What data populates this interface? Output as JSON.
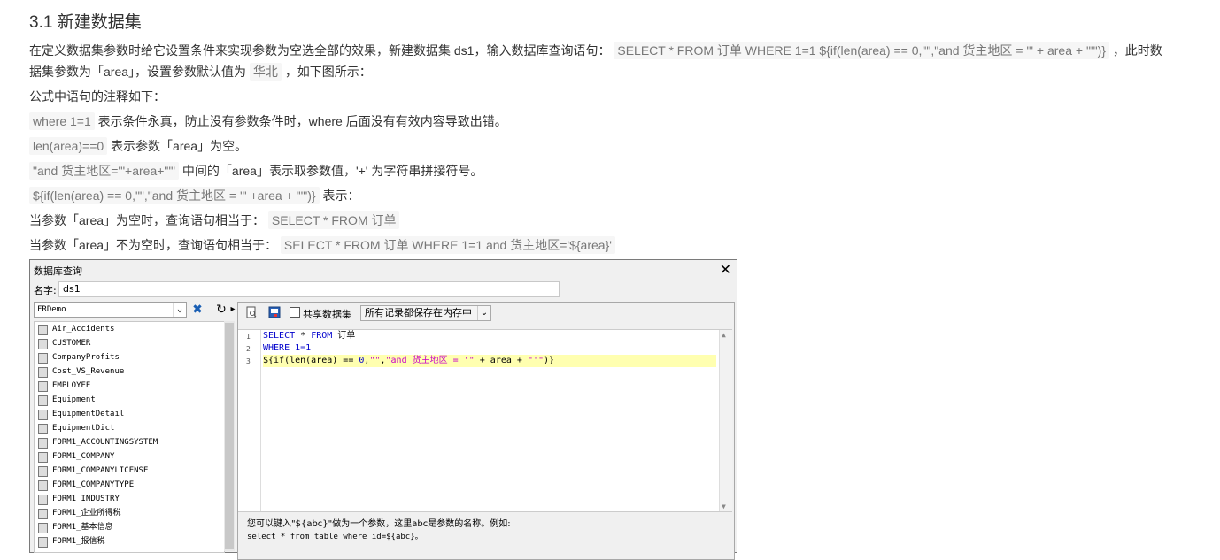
{
  "doc": {
    "heading": "3.1 新建数据集",
    "p1a": "在定义数据集参数时给它设置条件来实现参数为空选全部的效果，新建数据集 ds1，输入数据库查询语句：",
    "p1_code": "SELECT * FROM 订单  WHERE 1=1  ${if(len(area) == 0,\"\",\"and 货主地区 = '\" + area + \"'\")}",
    "p1b": "，此时数",
    "p2a": "据集参数为「area」，设置参数默认值为",
    "p2_code": "华北",
    "p2b": "，如下图所示：",
    "p3": "公式中语句的注释如下：",
    "n1_code": "where 1=1",
    "n1_text": "表示条件永真，防止没有参数条件时，where 后面没有有效内容导致出错。",
    "n2_code": "len(area)==0",
    "n2_text": "表示参数「area」为空。",
    "n3_code": "\"and 货主地区='\"+area+\"'\"",
    "n3_text": "中间的「area」表示取参数值，'+' 为字符串拼接符号。",
    "n4_code": "${if(len(area) == 0,\"\",\"and 货主地区 = '\" +area + \"'\")}",
    "n4_text": "表示：",
    "n5_text": "当参数「area」为空时，查询语句相当于：",
    "n5_code": "SELECT * FROM 订单",
    "n6_text": "当参数「area」不为空时，查询语句相当于：",
    "n6_code": "SELECT * FROM 订单 WHERE 1=1 and 货主地区='${area}'"
  },
  "dialog": {
    "title": "数据库查询",
    "close": "✕",
    "name_label": "名字:",
    "name_value": "ds1",
    "connection": "FRDemo",
    "share_label": "共享数据集",
    "mode": "所有记录都保存在内存中",
    "tables": [
      "Air_Accidents",
      "CUSTOMER",
      "CompanyProfits",
      "Cost_VS_Revenue",
      "EMPLOYEE",
      "Equipment",
      "EquipmentDetail",
      "EquipmentDict",
      "FORM1_ACCOUNTINGSYSTEM",
      "FORM1_COMPANY",
      "FORM1_COMPANYLICENSE",
      "FORM1_COMPANYTYPE",
      "FORM1_INDUSTRY",
      "FORM1_企业所得税",
      "FORM1_基本信息",
      "FORM1_报信税"
    ],
    "code": {
      "ln1": "1",
      "ln2": "2",
      "ln3": "3",
      "l1_kw1": "SELECT",
      "l1_mid": " * ",
      "l1_kw2": "FROM",
      "l1_tail": " 订单",
      "l2_kw": "WHERE",
      "l2_tail": " 1=1",
      "l3_a": "${if(len(area) == ",
      "l3_num": "0",
      "l3_b": ",",
      "l3_s1": "\"\"",
      "l3_c": ",",
      "l3_s2": "\"and 货主地区 = '\"",
      "l3_d": " + area + ",
      "l3_s3": "\"'\"",
      "l3_e": ")}"
    },
    "hint1": "您可以键入\"${abc}\"做为一个参数，这里abc是参数的名称。例如:",
    "hint2": "select * from table where id=${abc}。"
  }
}
